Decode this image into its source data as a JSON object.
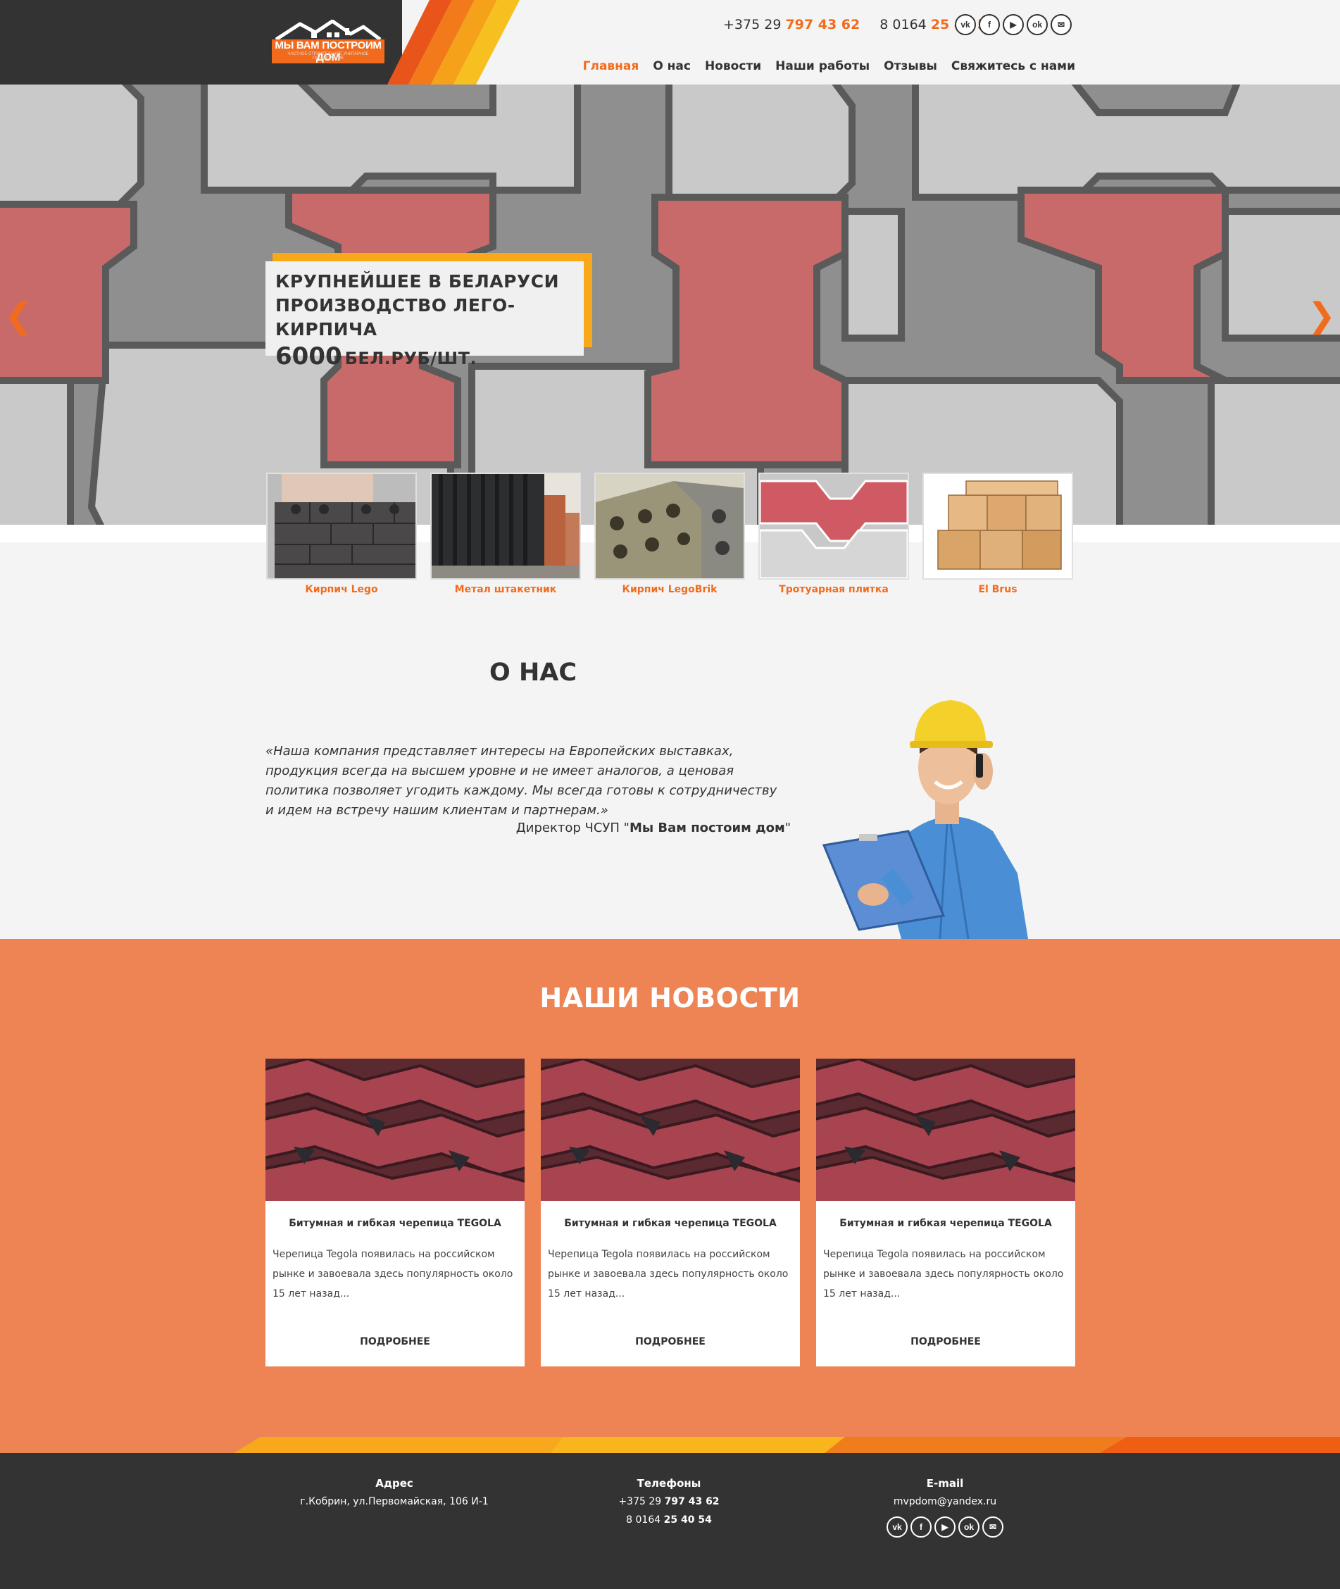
{
  "header": {
    "logo_title": "МЫ ВАМ ПОСТРОИМ ДОМ",
    "logo_subtitle": "ЧАСТНОЕ СТРОИТЕЛЬНОЕ УНИТАРНОЕ ПРЕДПРИЯТИЕ",
    "phone1_prefix": "+375 29",
    "phone1_number": "797 43 62",
    "phone2_prefix": "8 0164",
    "phone2_number": "25 40 54",
    "social": [
      "vk-icon",
      "facebook-icon",
      "youtube-icon",
      "odnoklassniki-icon",
      "mail-icon"
    ],
    "social_glyphs": [
      "vk",
      "f",
      "▶",
      "ok",
      "✉"
    ],
    "nav": [
      "Главная",
      "О нас",
      "Новости",
      "Наши работы",
      "Отзывы",
      "Свяжитесь с нами"
    ]
  },
  "hero": {
    "line1": "КРУПНЕЙШЕЕ В БЕЛАРУСИ",
    "line2": "ПРОИЗВОДСТВО ЛЕГО-КИРПИЧА",
    "price": "6000",
    "unit": "БЕЛ.РУБ/ШТ.",
    "prev": "❮",
    "next": "❯"
  },
  "products": [
    "Кирпич Lego",
    "Метал штакетник",
    "Кирпич LegoBrik",
    "Тротуарная плитка",
    "El Brus"
  ],
  "about": {
    "title": "О НАС",
    "quote": "«Наша компания представляет интересы на Европейских выставках, продукция всегда на высшем уровне и не имеет аналогов, а ценовая политика позволяет угодить каждому. Мы всегда готовы к сотрудничеству и идем на встречу нашим клиентам и партнерам.»",
    "director_prefix": "Директор ЧСУП \"",
    "director_name": "Мы Вам постоим дом",
    "director_suffix": "\""
  },
  "news": {
    "title": "НАШИ НОВОСТИ",
    "cards": [
      {
        "title": "Битумная и гибкая черепица TEGOLA",
        "text": "Черепица Tegola появилась на российском рынке и завоевала здесь популярность около 15 лет назад...",
        "more": "ПОДРОБНЕЕ"
      },
      {
        "title": "Битумная и гибкая черепица TEGOLA",
        "text": "Черепица Tegola появилась на российском рынке и завоевала здесь популярность около 15 лет назад...",
        "more": "ПОДРОБНЕЕ"
      },
      {
        "title": "Битумная и гибкая черепица TEGOLA",
        "text": "Черепица Tegola появилась на российском рынке и завоевала здесь популярность около 15 лет назад...",
        "more": "ПОДРОБНЕЕ"
      }
    ]
  },
  "footer": {
    "address_title": "Адрес",
    "address": "г.Кобрин, ул.Первомайская, 106 И-1",
    "phones_title": "Телефоны",
    "phone1_prefix": "+375 29",
    "phone1_number": "797 43 62",
    "phone2_prefix": "8 0164",
    "phone2_number": "25 40 54",
    "email_title": "E-mail",
    "email": "mvpdom@yandex.ru"
  },
  "colors": {
    "accent": "#f26b1d",
    "dark": "#333333",
    "news_bg": "#ee8454",
    "yellow": "#f8a818"
  }
}
